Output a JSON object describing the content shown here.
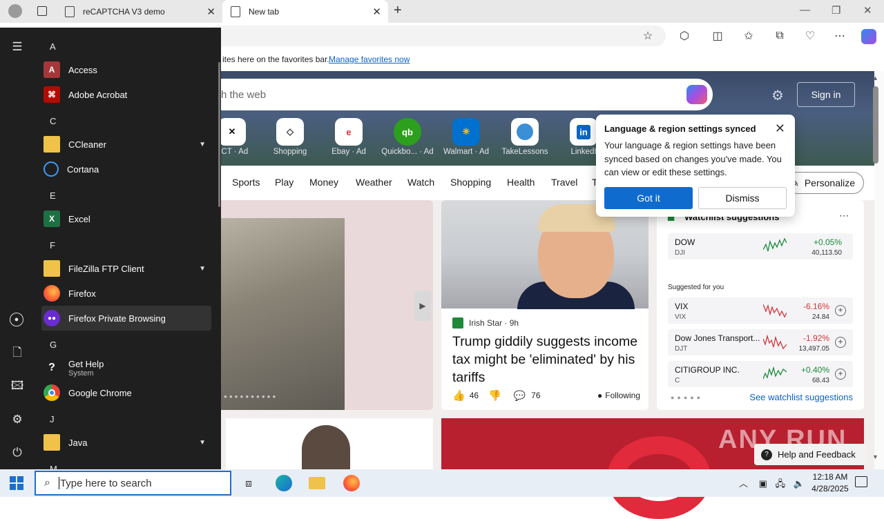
{
  "browser": {
    "tabs": [
      {
        "title": "reCAPTCHA V3 demo"
      },
      {
        "title": "New tab"
      }
    ],
    "favorites_bar": {
      "text": "ites here on the favorites bar.",
      "link": "Manage favorites now"
    }
  },
  "newtab": {
    "search_placeholder": "h the web",
    "sign_in": "Sign in",
    "quick_links": [
      {
        "label": "ACT · Ad",
        "icon": "x-logo-icon"
      },
      {
        "label": "Shopping",
        "icon": "tag-icon"
      },
      {
        "label": "Ebay · Ad",
        "icon": "ebay-icon"
      },
      {
        "label": "Quickbo... · Ad",
        "icon": "quickbooks-icon"
      },
      {
        "label": "Walmart · Ad",
        "icon": "walmart-icon"
      },
      {
        "label": "TakeLessons",
        "icon": "takelessons-icon"
      },
      {
        "label": "LinkedI",
        "icon": "linkedin-icon"
      }
    ],
    "nav": [
      "Sports",
      "Play",
      "Money",
      "Weather",
      "Watch",
      "Shopping",
      "Health",
      "Travel",
      "T"
    ],
    "personalize": "Personalize",
    "news_card": {
      "source": "Irish Star",
      "age": "9h",
      "headline": "Trump giddily suggests income tax might be 'eliminated' by his tariffs",
      "likes": "46",
      "comments": "76",
      "following": "Following"
    },
    "watchlist": {
      "title": "Watchlist suggestions",
      "top": {
        "name": "DOW",
        "symbol": "DJI",
        "change": "+0.05%",
        "price": "40,113.50",
        "color": "#1a8a3a"
      },
      "suggested_label": "Suggested for you",
      "suggested": [
        {
          "name": "VIX",
          "symbol": "VIX",
          "change": "-6.16%",
          "price": "24.84",
          "color": "#d13438"
        },
        {
          "name": "Dow Jones Transport...",
          "symbol": "DJT",
          "change": "-1.92%",
          "price": "13,497.05",
          "color": "#d13438"
        },
        {
          "name": "CITIGROUP INC.",
          "symbol": "C",
          "change": "+0.40%",
          "price": "68.43",
          "color": "#1a8a3a"
        }
      ],
      "see_more": "See watchlist suggestions"
    },
    "help": "Help and Feedback",
    "watermark": "ANY RUN"
  },
  "popup": {
    "title": "Language & region settings synced",
    "body": "Your language & region settings have been synced based on changes you've made. You can view or edit these settings.",
    "primary": "Got it",
    "secondary": "Dismiss"
  },
  "start_menu": {
    "groups": [
      {
        "letter": "A",
        "apps": [
          {
            "name": "Access",
            "icon": "access-icon"
          },
          {
            "name": "Adobe Acrobat",
            "icon": "acrobat-icon"
          }
        ]
      },
      {
        "letter": "C",
        "apps": [
          {
            "name": "CCleaner",
            "icon": "folder-icon",
            "expandable": true
          },
          {
            "name": "Cortana",
            "icon": "cortana-icon"
          }
        ]
      },
      {
        "letter": "E",
        "apps": [
          {
            "name": "Excel",
            "icon": "excel-icon"
          }
        ]
      },
      {
        "letter": "F",
        "apps": [
          {
            "name": "FileZilla FTP Client",
            "icon": "folder-icon",
            "expandable": true
          },
          {
            "name": "Firefox",
            "icon": "firefox-icon"
          },
          {
            "name": "Firefox Private Browsing",
            "icon": "firefox-private-icon"
          }
        ]
      },
      {
        "letter": "G",
        "apps": [
          {
            "name": "Get Help",
            "sub": "System",
            "icon": "get-help-icon"
          },
          {
            "name": "Google Chrome",
            "icon": "chrome-icon"
          }
        ]
      },
      {
        "letter": "J",
        "apps": [
          {
            "name": "Java",
            "icon": "folder-icon",
            "expandable": true
          }
        ]
      },
      {
        "letter": "M",
        "apps": []
      }
    ]
  },
  "taskbar": {
    "search_placeholder": "Type here to search",
    "time": "12:18 AM",
    "date": "4/28/2025"
  }
}
